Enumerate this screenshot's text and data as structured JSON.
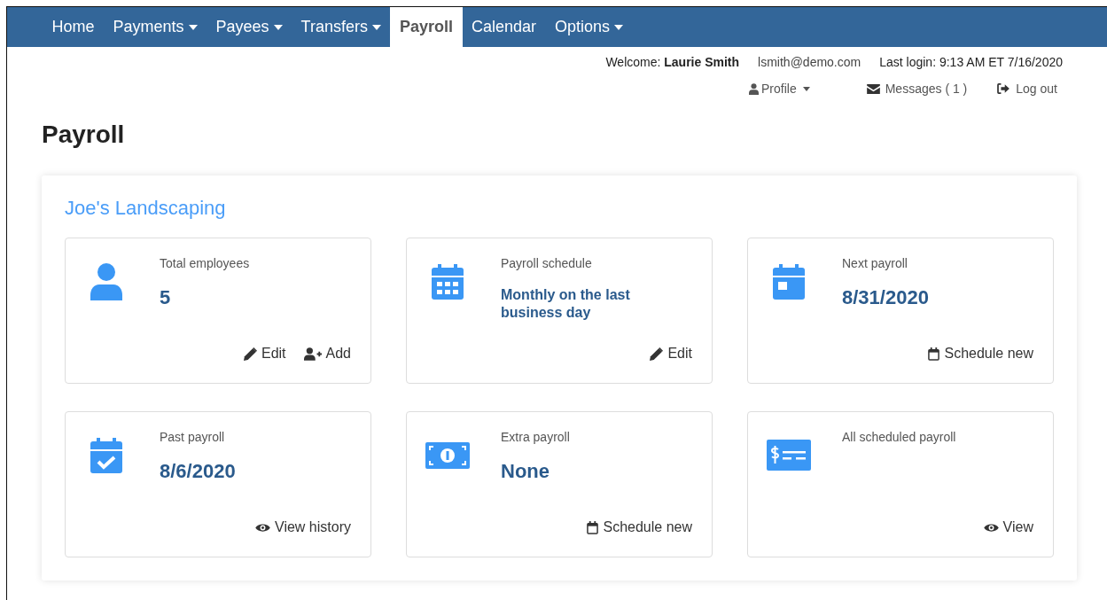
{
  "nav": {
    "items": [
      {
        "label": "Home",
        "dropdown": false,
        "selected": false
      },
      {
        "label": "Payments",
        "dropdown": true,
        "selected": false
      },
      {
        "label": "Payees",
        "dropdown": true,
        "selected": false
      },
      {
        "label": "Transfers",
        "dropdown": true,
        "selected": false
      },
      {
        "label": "Payroll",
        "dropdown": false,
        "selected": true
      },
      {
        "label": "Calendar",
        "dropdown": false,
        "selected": false
      },
      {
        "label": "Options",
        "dropdown": true,
        "selected": false
      }
    ]
  },
  "user_bar": {
    "welcome_label": "Welcome:",
    "user_name": "Laurie Smith",
    "email": "lsmith@demo.com",
    "last_login": "Last login: 9:13 AM ET 7/16/2020",
    "links": [
      {
        "kind": "profile",
        "label": "Profile"
      },
      {
        "kind": "messages",
        "label": "Messages ( 1 )"
      },
      {
        "kind": "logout",
        "label": "Log out"
      }
    ]
  },
  "page_title": "Payroll",
  "company": "Joe's Landscaping",
  "cards": [
    {
      "title": "Total employees",
      "value": "5",
      "actions": [
        {
          "label": "Edit"
        },
        {
          "label": "Add"
        }
      ]
    },
    {
      "title": "Payroll schedule",
      "value": "Monthly on the last business day",
      "actions": [
        {
          "label": "Edit"
        }
      ]
    },
    {
      "title": "Next payroll",
      "value": "8/31/2020",
      "actions": [
        {
          "label": "Schedule new"
        }
      ]
    },
    {
      "title": "Past payroll",
      "value": "8/6/2020",
      "actions": [
        {
          "label": "View history"
        }
      ]
    },
    {
      "title": "Extra payroll",
      "value": "None",
      "actions": [
        {
          "label": "Schedule new"
        }
      ]
    },
    {
      "title": "All scheduled payroll",
      "actions": [
        {
          "label": "View"
        }
      ]
    }
  ]
}
